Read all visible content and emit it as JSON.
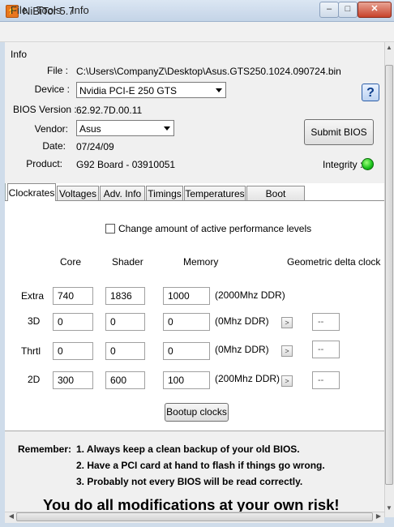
{
  "window": {
    "title": "NiBiTor 5.7",
    "icon": "nibitor-app-icon",
    "controls": {
      "minimize": "–",
      "maximize": "□",
      "close": "✕"
    }
  },
  "menu": [
    "File",
    "Tools",
    "Info"
  ],
  "info": {
    "section_title": "Info",
    "file_label": "File :",
    "file_value": "C:\\Users\\CompanyZ\\Desktop\\Asus.GTS250.1024.090724.bin",
    "device_label": "Device :",
    "device_value": "Nvidia PCI-E 250 GTS",
    "bios_version_label": "BIOS Version :",
    "bios_version_value": "62.92.7D.00.11",
    "vendor_label": "Vendor:",
    "vendor_value": "Asus",
    "date_label": "Date:",
    "date_value": "07/24/09",
    "product_label": "Product:",
    "product_value": "G92 Board - 03910051",
    "integrity_label": "Integrity :",
    "integrity_color": "#18c01a",
    "help_label": "?",
    "submit_label": "Submit BIOS"
  },
  "tabs": [
    "Clockrates",
    "Voltages",
    "Adv. Info",
    "Timings",
    "Temperatures",
    "Boot Settings"
  ],
  "clockrates": {
    "change_levels_label": "Change amount of active performance levels",
    "headers": {
      "core": "Core",
      "shader": "Shader",
      "memory": "Memory",
      "geometric": "Geometric delta clock"
    },
    "rows": [
      {
        "name": "Extra",
        "core": "740",
        "shader": "1836",
        "memory": "1000",
        "ddr": "(2000Mhz DDR)",
        "delta": ""
      },
      {
        "name": "3D",
        "core": "0",
        "shader": "0",
        "memory": "0",
        "ddr": "(0Mhz DDR)",
        "delta": "--"
      },
      {
        "name": "Thrtl",
        "core": "0",
        "shader": "0",
        "memory": "0",
        "ddr": "(0Mhz DDR)",
        "delta": "--"
      },
      {
        "name": "2D",
        "core": "300",
        "shader": "600",
        "memory": "100",
        "ddr": "(200Mhz DDR)",
        "delta": "--"
      }
    ],
    "bootup_label": "Bootup clocks",
    "arrow_glyph": ">"
  },
  "remember": {
    "label": "Remember:",
    "lines": [
      "1. Always keep a clean backup of your old BIOS.",
      "2. Have a PCI card at hand to flash if things go wrong.",
      "3. Probably not every BIOS will be read correctly."
    ],
    "warning": "You do all modifications at your own risk!"
  },
  "scrollbars": {
    "up": "▲",
    "down": "▼",
    "left": "◀",
    "right": "▶"
  }
}
